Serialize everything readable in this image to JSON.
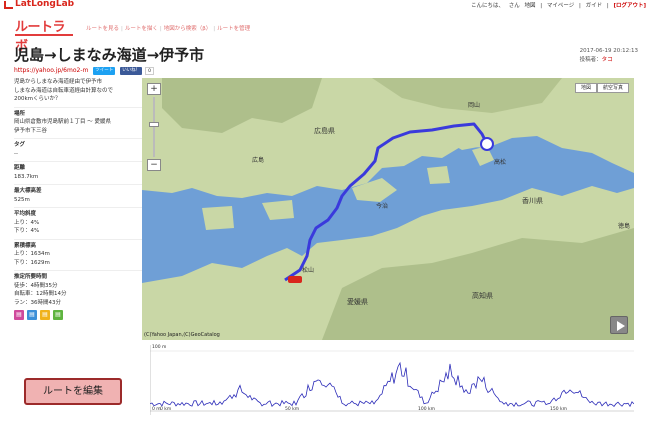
{
  "header": {
    "brand": "LatLongLab",
    "greeting": "こんにちは、",
    "user": "さん",
    "links": [
      "地図",
      "マイページ",
      "ガイド"
    ],
    "logout": "[ログアウト]"
  },
  "app": {
    "logo": "ルートラボ",
    "nav": [
      "ルートを見る",
      "ルートを描く",
      "地図から検索（β）",
      "ルートを管理"
    ]
  },
  "route": {
    "title": "児島→しまなみ海道→伊予市",
    "short_url": "https://yahoo.jp/6mo2-m",
    "tweet": "ツイート",
    "like": "いいね！",
    "like_count": "0",
    "timestamp": "2017-06-19 20:12:13",
    "author_label": "投稿者：",
    "author": "タコ"
  },
  "sidebar": {
    "description": [
      "児島からしまなみ海道経由で伊予市",
      "しまなみ海道は自転車道経由計算なので",
      "200kmくらいか？"
    ],
    "place_label": "場所",
    "place_value": [
      "岡山県倉敷市児島駅前１丁目 〜 愛媛県",
      "伊予市下三谷"
    ],
    "tags_label": "タグ",
    "tags_value": "--",
    "distance_label": "距離",
    "distance_value": "183.7km",
    "max_alt_label": "最大標高差",
    "max_alt_value": "525m",
    "avg_grade_label": "平均斜度",
    "avg_grade_up": "上り：4%",
    "avg_grade_down": "下り：4%",
    "cum_label": "累積標高",
    "cum_up": "上り：1634m",
    "cum_down": "下り：1629m",
    "time_label": "推定所要時間",
    "time_walk": "徒歩：4時間35分",
    "time_bike": "自転車：12時間14分",
    "time_run": "ラン：36時間43分",
    "share_icons": [
      "pdf-icon",
      "gpx-icon",
      "kml-icon",
      "csv-icon"
    ],
    "edit_button": "ルートを編集"
  },
  "map": {
    "map_types": [
      "地図",
      "航空写真"
    ],
    "credit": "(C)Yahoo Japan,(C)GeoCatalog",
    "labels": [
      {
        "text": "広島県",
        "kind": "pref"
      },
      {
        "text": "岡山",
        "kind": "city"
      },
      {
        "text": "高松",
        "kind": "city"
      },
      {
        "text": "香川県",
        "kind": "pref"
      },
      {
        "text": "愛媛県",
        "kind": "pref"
      },
      {
        "text": "高知県",
        "kind": "pref"
      },
      {
        "text": "松山",
        "kind": "city"
      },
      {
        "text": "広島",
        "kind": "city"
      },
      {
        "text": "今治",
        "kind": "city"
      },
      {
        "text": "徳島",
        "kind": "city"
      }
    ],
    "colors": {
      "sea": "#6f9fd6",
      "land": "#c9d7a6",
      "mountain": "#98ab74",
      "route": "#3a3adc"
    }
  },
  "elevation": {
    "y_top_label": "100 m",
    "y_bottom_label": "0 m",
    "x_labels": [
      "0 km",
      "50 km",
      "100 km",
      "150 km"
    ]
  }
}
